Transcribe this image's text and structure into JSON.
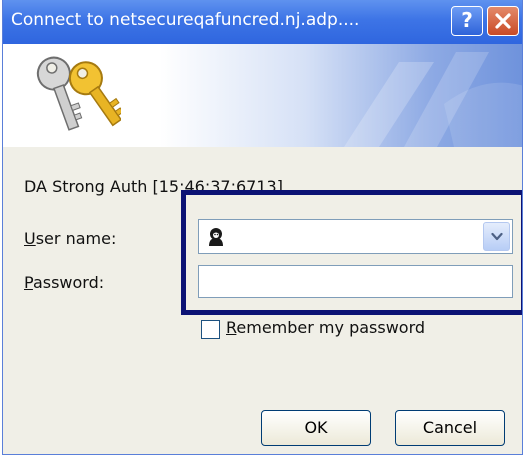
{
  "window": {
    "title": "Connect to netsecureqafuncred.nj.adp....",
    "help_button": "?",
    "close_button": "X"
  },
  "banner": {
    "icon": "keys-icon"
  },
  "form": {
    "realm_text": "DA Strong Auth [15:46:37:6713]",
    "user_label_accel": "U",
    "user_label_rest": "ser name:",
    "user_value": "",
    "user_icon": "user-avatar-icon",
    "password_label_accel": "P",
    "password_label_rest": "assword:",
    "password_value": "",
    "remember_accel": "R",
    "remember_rest": "emember my password",
    "remember_checked": false
  },
  "buttons": {
    "ok": "OK",
    "cancel": "Cancel"
  },
  "colors": {
    "titlebar": "#3d74e6",
    "highlight_box": "#0c1375",
    "dialog_background": "#f0efe7"
  }
}
